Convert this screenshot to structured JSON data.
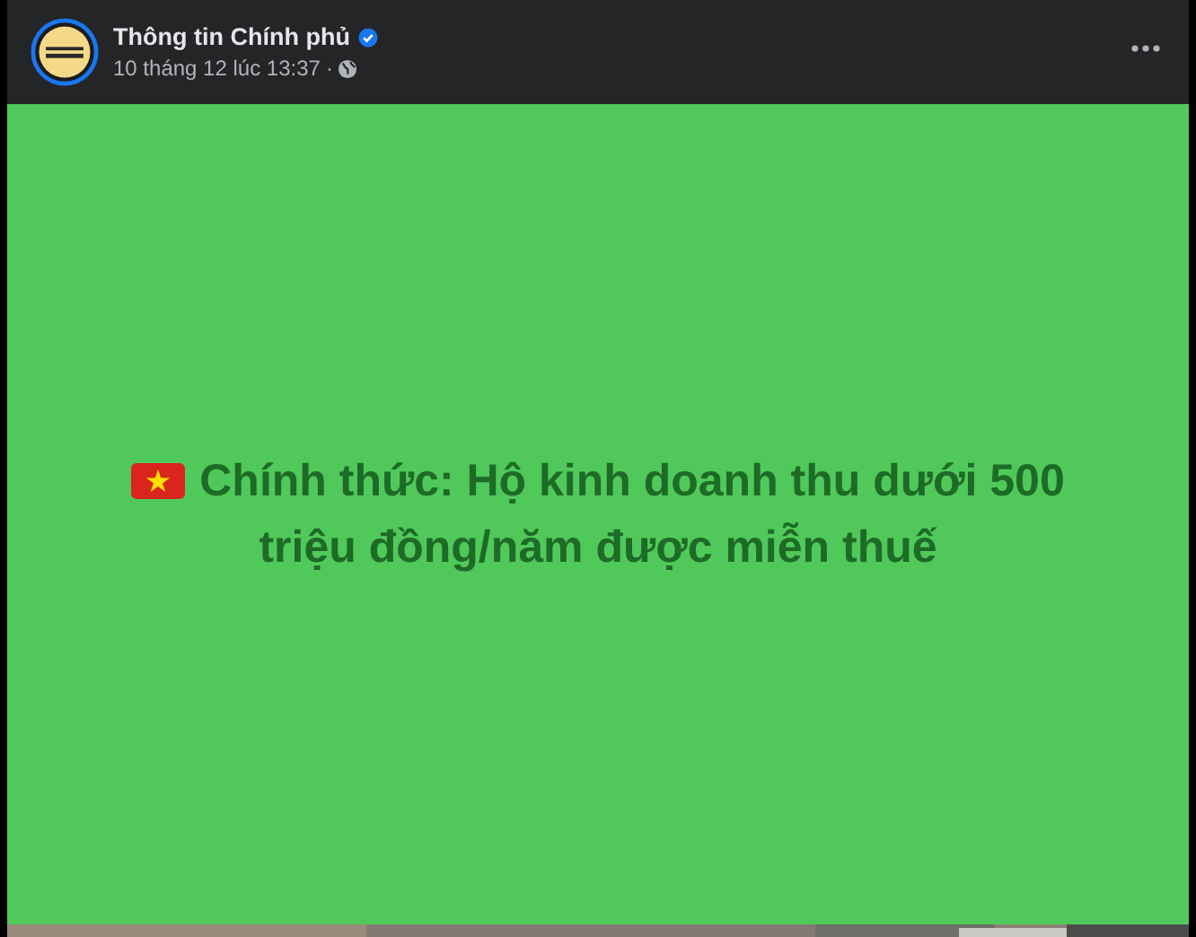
{
  "post": {
    "author": "Thông tin Chính phủ",
    "verified": true,
    "timestamp": "10 tháng 12 lúc 13:37",
    "separator": "·",
    "headline": "Chính thức: Hộ kinh doanh thu dưới 500 triệu đồng/năm được miễn thuế"
  }
}
